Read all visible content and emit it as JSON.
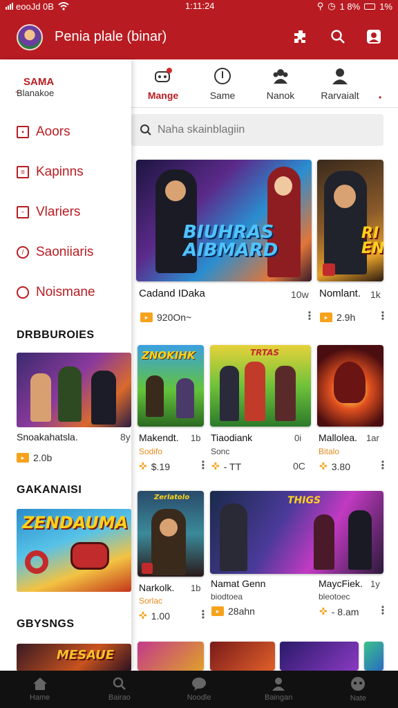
{
  "status_bar": {
    "carrier": "eooJd 0B",
    "time": "1:11:24",
    "battery": "1 8%",
    "extra": "1%"
  },
  "app_bar": {
    "title": "Penia plale (binar)"
  },
  "sidebar": {
    "brand_top": "SAMA",
    "brand_sub": "Blanakoe",
    "items": [
      {
        "label": "Aoors"
      },
      {
        "label": "Kapinns"
      },
      {
        "label": "Vlariers"
      },
      {
        "label": "Saoniiaris"
      },
      {
        "label": "Noismane"
      }
    ],
    "sections": [
      {
        "title": "DRBBUROIES",
        "card_name": "Snoakahatsla.",
        "card_right": "8y",
        "card_meta": "2.0b"
      },
      {
        "title": "GAKANAISI",
        "art_text": "ZENDAUMA"
      },
      {
        "title": "GBYSNGS",
        "art_text": "MESAUE"
      }
    ]
  },
  "tabs": [
    {
      "label": "Mange",
      "icon": "controller-icon"
    },
    {
      "label": "Same",
      "icon": "compass-icon"
    },
    {
      "label": "Nanok",
      "icon": "group-icon"
    },
    {
      "label": "Rarvaialt",
      "icon": "person-icon"
    }
  ],
  "search": {
    "placeholder": "Naha skainblagiin"
  },
  "featured": [
    {
      "title": "Cadand IDaka",
      "right": "10w",
      "meta": "920On~",
      "art": "BIUHRAS AIBMARD"
    },
    {
      "title": "Nomlant.",
      "right": "1k",
      "meta": "2.9h",
      "art": "RI EN"
    }
  ],
  "grid_row1": [
    {
      "title": "Makendt.",
      "right": "1b",
      "sub": "Sodifo",
      "meta": "$.19",
      "art": "ZNOKIHK"
    },
    {
      "title": "Tiaodiank",
      "right": "0i",
      "sub": "Sonc",
      "meta": "- TT",
      "meta_right": "0C",
      "art": "TRTAS"
    },
    {
      "title": "Mallolea.",
      "right": "1ar",
      "sub": "Bitalo",
      "meta": "3.80"
    }
  ],
  "grid_row2": [
    {
      "title": "Narkolk.",
      "right": "1b",
      "sub": "Sorlac",
      "meta": "1.00",
      "art": "Zerlatolo"
    },
    {
      "title": "Namat Genn",
      "sub": "biodtoea",
      "meta": "28ahn",
      "art": "THIGS"
    },
    {
      "title": "MaycFiek.",
      "right": "1y",
      "sub": "bleotoec",
      "meta": "- 8.am"
    }
  ],
  "bottom_nav": [
    {
      "label": "Hame",
      "icon": "home-icon"
    },
    {
      "label": "Bairao",
      "icon": "search-icon"
    },
    {
      "label": "Noodle",
      "icon": "chat-icon"
    },
    {
      "label": "Baingan",
      "icon": "profile-icon"
    },
    {
      "label": "Nate",
      "icon": "game-icon"
    }
  ],
  "colors": {
    "brand_red": "#b81c22",
    "accent_orange": "#f7a21b",
    "bottom_bar": "#111111"
  }
}
